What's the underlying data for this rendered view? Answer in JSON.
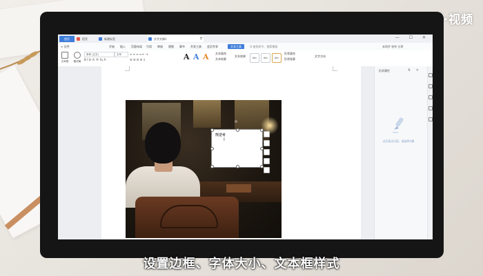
{
  "watermark": "天奇·视频",
  "subtitle": "设置边框、字体大小、文本框样式",
  "titlebar": {
    "home_tab": "首页",
    "tabs": [
      {
        "label": "稻壳",
        "color": "#e6574a"
      },
      {
        "label": "新建标签",
        "color": "#3e7ddb"
      },
      {
        "label": "文字文稿1",
        "color": "#3e7ddb",
        "active": true
      }
    ],
    "new_tab": "+",
    "window_buttons": "— ☐ ✕"
  },
  "menubar": {
    "file_menu": "≡ 文件",
    "items": [
      "开始",
      "插入",
      "页面布局",
      "引用",
      "审阅",
      "视图",
      "章节",
      "开发工具",
      "会员专享"
    ],
    "highlighted": "文本工具",
    "search": "Q 查找命令、搜索模板",
    "right_tools": "未同步 协作 分享"
  },
  "ribbon": {
    "text_box_label": "文本框",
    "format_label": "格式刷",
    "font_name": "宋体 (正文)",
    "font_size": "五号",
    "text_fill_label": "文本填充",
    "text_outline_label": "文本轮廓",
    "text_effect_label": "文本效果",
    "shape_fill_label": "形状填充",
    "shape_outline_label": "形状轮廓",
    "text_direction_label": "文字方向",
    "style_boxes": [
      "Abc",
      "Abc",
      "Abc"
    ],
    "big_a_colors": [
      "#222222",
      "#3e7ddb",
      "#e88a2b"
    ]
  },
  "document": {
    "textbox_text": "熊逆考",
    "cursor": "I"
  },
  "sidepane": {
    "title": "形状属性",
    "controls": "⇅ ✕",
    "empty_hint": "此页面无内容，请选择对象"
  }
}
